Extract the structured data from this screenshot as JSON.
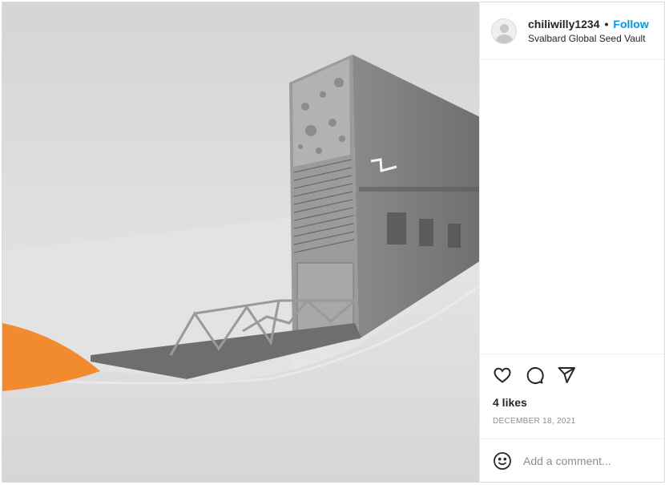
{
  "post": {
    "image_alt": "Svalbard Global Seed Vault entrance in snow"
  },
  "header": {
    "username": "chiliwilly1234",
    "separator": "•",
    "follow_label": "Follow",
    "location": "Svalbard Global Seed Vault"
  },
  "actions": {
    "icons": [
      "heart-icon",
      "comment-icon",
      "share-icon"
    ],
    "likes": "4 likes",
    "date": "December 18, 2021"
  },
  "comment": {
    "placeholder": "Add a comment...",
    "emoji_icon": "smiley-icon"
  },
  "colors": {
    "accent": "#0095f6",
    "border": "#dbdbdb",
    "muted": "#8e8e8e",
    "highlight": "#f28a30"
  }
}
